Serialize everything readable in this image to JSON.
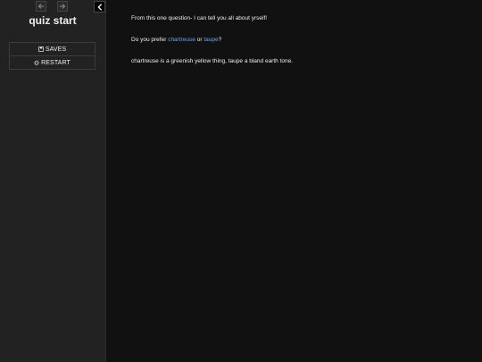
{
  "sidebar": {
    "history_back_icon": "left-arrow-icon",
    "history_forward_icon": "right-arrow-icon",
    "toggle_icon": "chevron-left-icon",
    "title": "quiz start",
    "menu": {
      "saves_label": "SAVES",
      "saves_icon": "floppy-disk-icon",
      "restart_label": "RESTART",
      "restart_icon": "power-icon"
    }
  },
  "passage": {
    "line1": "From this one question- I can tell you all about yrself!",
    "line2_prefix": "Do you prefer ",
    "link1": "chartreuse",
    "line2_middle": " or ",
    "link2": "taupe",
    "line2_suffix": "?",
    "line3": "chartreuse is a greenish yellow thing, taupe a bland earth tone."
  },
  "colors": {
    "background": "#111111",
    "sidebar": "#222222",
    "link": "#68a6f2",
    "text": "#eeeeee"
  }
}
